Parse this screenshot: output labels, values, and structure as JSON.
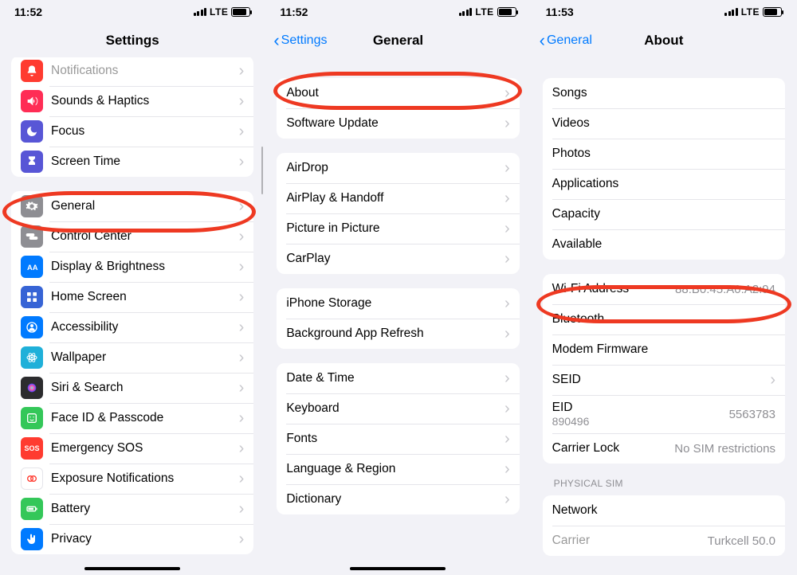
{
  "phone1": {
    "time": "11:52",
    "network": "LTE",
    "title": "Settings",
    "rows": [
      {
        "label": "Notifications",
        "iconColor": "#ff3b30",
        "iconKey": "bell",
        "trunc": true
      },
      {
        "label": "Sounds & Haptics",
        "iconColor": "#ff2d55",
        "iconKey": "sound"
      },
      {
        "label": "Focus",
        "iconColor": "#5856d6",
        "iconKey": "moon"
      },
      {
        "label": "Screen Time",
        "iconColor": "#5856d6",
        "iconKey": "hourglass"
      }
    ],
    "rows2": [
      {
        "label": "General",
        "iconColor": "#8e8e93",
        "iconKey": "gear",
        "highlighted": true
      },
      {
        "label": "Control Center",
        "iconColor": "#8e8e93",
        "iconKey": "switches"
      },
      {
        "label": "Display & Brightness",
        "iconColor": "#007aff",
        "iconKey": "aa"
      },
      {
        "label": "Home Screen",
        "iconColor": "#3764d5",
        "iconKey": "grid"
      },
      {
        "label": "Accessibility",
        "iconColor": "#007aff",
        "iconKey": "person"
      },
      {
        "label": "Wallpaper",
        "iconColor": "#1fb0d9",
        "iconKey": "atom"
      },
      {
        "label": "Siri & Search",
        "iconColor": "#2c2c2e",
        "iconKey": "siri"
      },
      {
        "label": "Face ID & Passcode",
        "iconColor": "#34c759",
        "iconKey": "face"
      },
      {
        "label": "Emergency SOS",
        "iconColor": "#ff3b30",
        "iconKey": "sos",
        "textIcon": "SOS"
      },
      {
        "label": "Exposure Notifications",
        "iconColor": "#ffffff",
        "iconKey": "exposure"
      },
      {
        "label": "Battery",
        "iconColor": "#34c759",
        "iconKey": "battery"
      },
      {
        "label": "Privacy",
        "iconColor": "#007aff",
        "iconKey": "hand"
      }
    ]
  },
  "phone2": {
    "time": "11:52",
    "network": "LTE",
    "back": "Settings",
    "title": "General",
    "group1": [
      {
        "label": "About",
        "highlighted": true
      },
      {
        "label": "Software Update"
      }
    ],
    "group2": [
      {
        "label": "AirDrop"
      },
      {
        "label": "AirPlay & Handoff"
      },
      {
        "label": "Picture in Picture"
      },
      {
        "label": "CarPlay"
      }
    ],
    "group3": [
      {
        "label": "iPhone Storage"
      },
      {
        "label": "Background App Refresh"
      }
    ],
    "group4": [
      {
        "label": "Date & Time"
      },
      {
        "label": "Keyboard"
      },
      {
        "label": "Fonts"
      },
      {
        "label": "Language & Region"
      },
      {
        "label": "Dictionary"
      }
    ]
  },
  "phone3": {
    "time": "11:53",
    "network": "LTE",
    "back": "General",
    "title": "About",
    "group1": [
      {
        "label": "Songs"
      },
      {
        "label": "Videos"
      },
      {
        "label": "Photos"
      },
      {
        "label": "Applications"
      },
      {
        "label": "Capacity"
      },
      {
        "label": "Available"
      }
    ],
    "group2": [
      {
        "label": "Wi-Fi Address",
        "value": "88:B0:45:A0:A2:94",
        "highlighted": true
      },
      {
        "label": "Bluetooth"
      },
      {
        "label": "Modem Firmware"
      },
      {
        "label": "SEID",
        "chevron": true
      },
      {
        "label": "EID",
        "sublabel": "890496",
        "value": "5563783"
      },
      {
        "label": "Carrier Lock",
        "value": "No SIM restrictions"
      }
    ],
    "section2_label": "PHYSICAL SIM",
    "group3": [
      {
        "label": "Network"
      },
      {
        "label": "Carrier",
        "value": "Turkcell 50.0",
        "trunc": true
      }
    ]
  }
}
